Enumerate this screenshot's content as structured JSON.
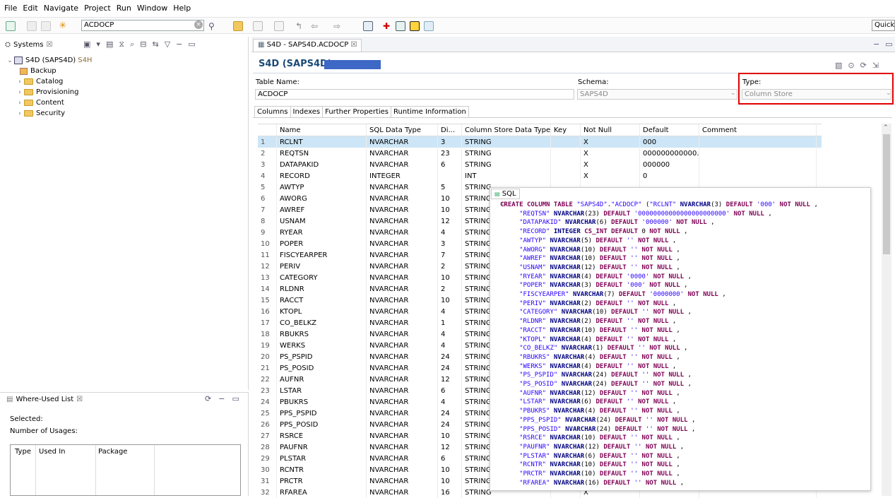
{
  "menu": [
    "File",
    "Edit",
    "Navigate",
    "Project",
    "Run",
    "Window",
    "Help"
  ],
  "toolbar": {
    "search_value": "ACDOCP",
    "quick_access": "Quick"
  },
  "systems": {
    "tab": "Systems",
    "root": "S4D (SAPS4D)",
    "root_suffix": "S4H",
    "items": [
      "Backup",
      "Catalog",
      "Provisioning",
      "Content",
      "Security"
    ]
  },
  "whereused": {
    "tab": "Where-Used List",
    "selected": "Selected:",
    "usages": "Number of Usages:",
    "cols": [
      "Type",
      "Used In",
      "Package"
    ]
  },
  "editor": {
    "tab": "S4D - SAPS4D.ACDOCP",
    "title": "S4D (SAPS4D)",
    "table_name_label": "Table Name:",
    "table_name": "ACDOCP",
    "schema_label": "Schema:",
    "schema": "SAPS4D",
    "type_label": "Type:",
    "type": "Column Store",
    "subtabs": [
      "Columns",
      "Indexes",
      "Further Properties",
      "Runtime Information"
    ]
  },
  "grid": {
    "headers": [
      "",
      "Name",
      "SQL Data Type",
      "Di...",
      "Column Store Data Type",
      "Key",
      "Not Null",
      "Default",
      "Comment"
    ],
    "rows": [
      [
        "1",
        "RCLNT",
        "NVARCHAR",
        "3",
        "STRING",
        "",
        "X",
        "000",
        ""
      ],
      [
        "2",
        "REQTSN",
        "NVARCHAR",
        "23",
        "STRING",
        "",
        "X",
        "000000000000...",
        ""
      ],
      [
        "3",
        "DATAPAKID",
        "NVARCHAR",
        "6",
        "STRING",
        "",
        "X",
        "000000",
        ""
      ],
      [
        "4",
        "RECORD",
        "INTEGER",
        "",
        "INT",
        "",
        "X",
        "0",
        ""
      ],
      [
        "5",
        "AWTYP",
        "NVARCHAR",
        "5",
        "STRING",
        "",
        "",
        "",
        ""
      ],
      [
        "6",
        "AWORG",
        "NVARCHAR",
        "10",
        "STRING",
        "",
        "",
        "",
        ""
      ],
      [
        "7",
        "AWREF",
        "NVARCHAR",
        "10",
        "STRING",
        "",
        "",
        "",
        ""
      ],
      [
        "8",
        "USNAM",
        "NVARCHAR",
        "12",
        "STRING",
        "",
        "",
        "",
        ""
      ],
      [
        "9",
        "RYEAR",
        "NVARCHAR",
        "4",
        "STRING",
        "",
        "",
        "",
        ""
      ],
      [
        "10",
        "POPER",
        "NVARCHAR",
        "3",
        "STRING",
        "",
        "",
        "",
        ""
      ],
      [
        "11",
        "FISCYEARPER",
        "NVARCHAR",
        "7",
        "STRING",
        "",
        "",
        "",
        ""
      ],
      [
        "12",
        "PERIV",
        "NVARCHAR",
        "2",
        "STRING",
        "",
        "",
        "",
        ""
      ],
      [
        "13",
        "CATEGORY",
        "NVARCHAR",
        "10",
        "STRING",
        "",
        "",
        "",
        ""
      ],
      [
        "14",
        "RLDNR",
        "NVARCHAR",
        "2",
        "STRING",
        "",
        "",
        "",
        ""
      ],
      [
        "15",
        "RACCT",
        "NVARCHAR",
        "10",
        "STRING",
        "",
        "",
        "",
        ""
      ],
      [
        "16",
        "KTOPL",
        "NVARCHAR",
        "4",
        "STRING",
        "",
        "",
        "",
        ""
      ],
      [
        "17",
        "CO_BELKZ",
        "NVARCHAR",
        "1",
        "STRING",
        "",
        "",
        "",
        ""
      ],
      [
        "18",
        "RBUKRS",
        "NVARCHAR",
        "4",
        "STRING",
        "",
        "",
        "",
        ""
      ],
      [
        "19",
        "WERKS",
        "NVARCHAR",
        "4",
        "STRING",
        "",
        "",
        "",
        ""
      ],
      [
        "20",
        "PS_PSPID",
        "NVARCHAR",
        "24",
        "STRING",
        "",
        "",
        "",
        ""
      ],
      [
        "21",
        "PS_POSID",
        "NVARCHAR",
        "24",
        "STRING",
        "",
        "",
        "",
        ""
      ],
      [
        "22",
        "AUFNR",
        "NVARCHAR",
        "12",
        "STRING",
        "",
        "",
        "",
        ""
      ],
      [
        "23",
        "LSTAR",
        "NVARCHAR",
        "6",
        "STRING",
        "",
        "",
        "",
        ""
      ],
      [
        "24",
        "PBUKRS",
        "NVARCHAR",
        "4",
        "STRING",
        "",
        "",
        "",
        ""
      ],
      [
        "25",
        "PPS_PSPID",
        "NVARCHAR",
        "24",
        "STRING",
        "",
        "",
        "",
        ""
      ],
      [
        "26",
        "PPS_POSID",
        "NVARCHAR",
        "24",
        "STRING",
        "",
        "",
        "",
        ""
      ],
      [
        "27",
        "RSRCE",
        "NVARCHAR",
        "10",
        "STRING",
        "",
        "",
        "",
        ""
      ],
      [
        "28",
        "PAUFNR",
        "NVARCHAR",
        "12",
        "STRING",
        "",
        "",
        "",
        ""
      ],
      [
        "29",
        "PLSTAR",
        "NVARCHAR",
        "6",
        "STRING",
        "",
        "",
        "",
        ""
      ],
      [
        "30",
        "RCNTR",
        "NVARCHAR",
        "10",
        "STRING",
        "",
        "",
        "",
        ""
      ],
      [
        "31",
        "PRCTR",
        "NVARCHAR",
        "10",
        "STRING",
        "",
        "",
        "",
        ""
      ],
      [
        "32",
        "RFAREA",
        "NVARCHAR",
        "16",
        "STRING",
        "",
        "X",
        "",
        ""
      ]
    ]
  },
  "sql": {
    "tab": "SQL",
    "lines": [
      "CREATE COLUMN TABLE \"SAPS4D\".\"ACDOCP\" (\"RCLNT\" NVARCHAR(3) DEFAULT '000' NOT NULL ,",
      "     \"REQTSN\" NVARCHAR(23) DEFAULT '00000000000000000000000' NOT NULL ,",
      "     \"DATAPAKID\" NVARCHAR(6) DEFAULT '000000' NOT NULL ,",
      "     \"RECORD\" INTEGER CS_INT DEFAULT 0 NOT NULL ,",
      "     \"AWTYP\" NVARCHAR(5) DEFAULT '' NOT NULL ,",
      "     \"AWORG\" NVARCHAR(10) DEFAULT '' NOT NULL ,",
      "     \"AWREF\" NVARCHAR(10) DEFAULT '' NOT NULL ,",
      "     \"USNAM\" NVARCHAR(12) DEFAULT '' NOT NULL ,",
      "     \"RYEAR\" NVARCHAR(4) DEFAULT '0000' NOT NULL ,",
      "     \"POPER\" NVARCHAR(3) DEFAULT '000' NOT NULL ,",
      "     \"FISCYEARPER\" NVARCHAR(7) DEFAULT '0000000' NOT NULL ,",
      "     \"PERIV\" NVARCHAR(2) DEFAULT '' NOT NULL ,",
      "     \"CATEGORY\" NVARCHAR(10) DEFAULT '' NOT NULL ,",
      "     \"RLDNR\" NVARCHAR(2) DEFAULT '' NOT NULL ,",
      "     \"RACCT\" NVARCHAR(10) DEFAULT '' NOT NULL ,",
      "     \"KTOPL\" NVARCHAR(4) DEFAULT '' NOT NULL ,",
      "     \"CO_BELKZ\" NVARCHAR(1) DEFAULT '' NOT NULL ,",
      "     \"RBUKRS\" NVARCHAR(4) DEFAULT '' NOT NULL ,",
      "     \"WERKS\" NVARCHAR(4) DEFAULT '' NOT NULL ,",
      "     \"PS_PSPID\" NVARCHAR(24) DEFAULT '' NOT NULL ,",
      "     \"PS_POSID\" NVARCHAR(24) DEFAULT '' NOT NULL ,",
      "     \"AUFNR\" NVARCHAR(12) DEFAULT '' NOT NULL ,",
      "     \"LSTAR\" NVARCHAR(6) DEFAULT '' NOT NULL ,",
      "     \"PBUKRS\" NVARCHAR(4) DEFAULT '' NOT NULL ,",
      "     \"PPS_PSPID\" NVARCHAR(24) DEFAULT '' NOT NULL ,",
      "     \"PPS_POSID\" NVARCHAR(24) DEFAULT '' NOT NULL ,",
      "     \"RSRCE\" NVARCHAR(10) DEFAULT '' NOT NULL ,",
      "     \"PAUFNR\" NVARCHAR(12) DEFAULT '' NOT NULL ,",
      "     \"PLSTAR\" NVARCHAR(6) DEFAULT '' NOT NULL ,",
      "     \"RCNTR\" NVARCHAR(10) DEFAULT '' NOT NULL ,",
      "     \"PRCTR\" NVARCHAR(10) DEFAULT '' NOT NULL ,",
      "     \"RFAREA\" NVARCHAR(16) DEFAULT '' NOT NULL ,"
    ]
  },
  "colors": {
    "title": "#1b4b78",
    "highlight": "#e00000",
    "selection": "#cde6f7"
  }
}
